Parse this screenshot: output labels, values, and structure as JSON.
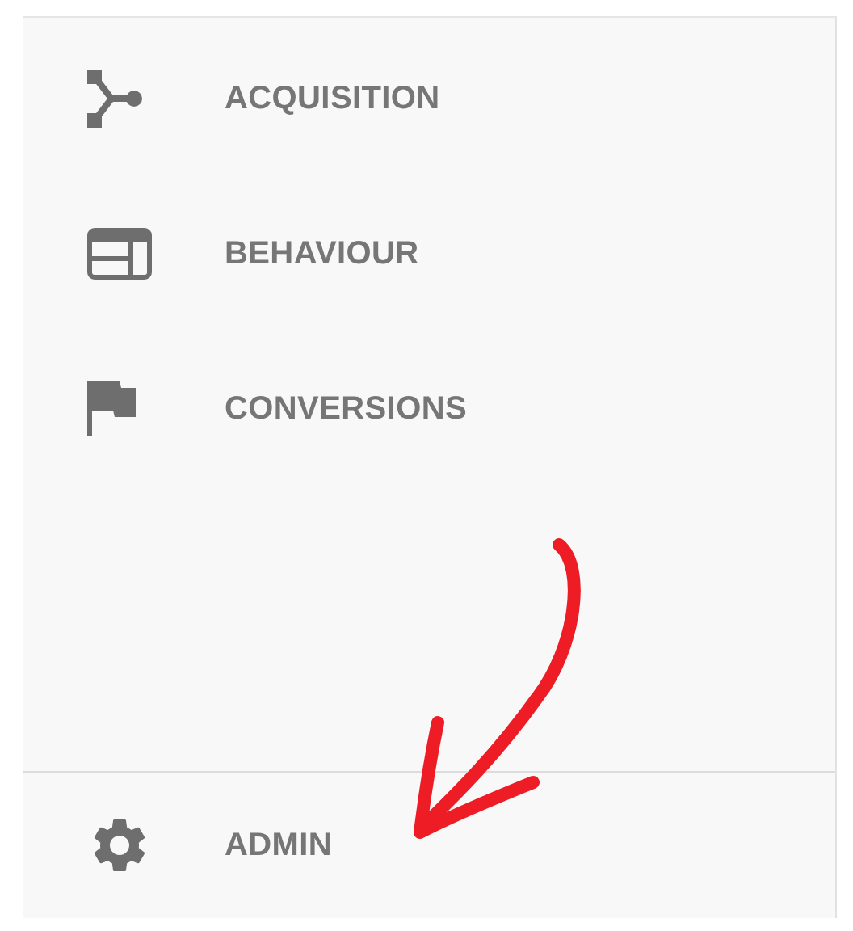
{
  "nav_items": [
    {
      "label": "ACQUISITION"
    },
    {
      "label": "BEHAVIOUR"
    },
    {
      "label": "CONVERSIONS"
    }
  ],
  "footer_item": {
    "label": "ADMIN"
  }
}
